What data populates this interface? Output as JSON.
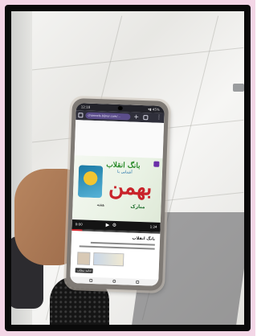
{
  "photo": {
    "description_colors": {
      "frame": "#0a0a0a",
      "floor_tile": "#e9e8e4",
      "page_background": "#f3d6e6"
    }
  },
  "phone": {
    "status_bar": {
      "time": "12:18",
      "right_indicators": "▾▮ 45%"
    },
    "browser": {
      "url": "channels.bijnor.com/..."
    },
    "video": {
      "title": "بانگ انقلاب",
      "subtitle": "آشنایی با",
      "caption_left": "هفته",
      "caption_right": "مبارک",
      "calligraphy": "بهمن"
    },
    "player": {
      "current_time": "0:00",
      "end_label": "1:24",
      "progress": 0.12,
      "progress_color": "#d8232a"
    },
    "content": {
      "title": "بانگ انقلاب",
      "button_label": "ادامه مطلب"
    }
  }
}
